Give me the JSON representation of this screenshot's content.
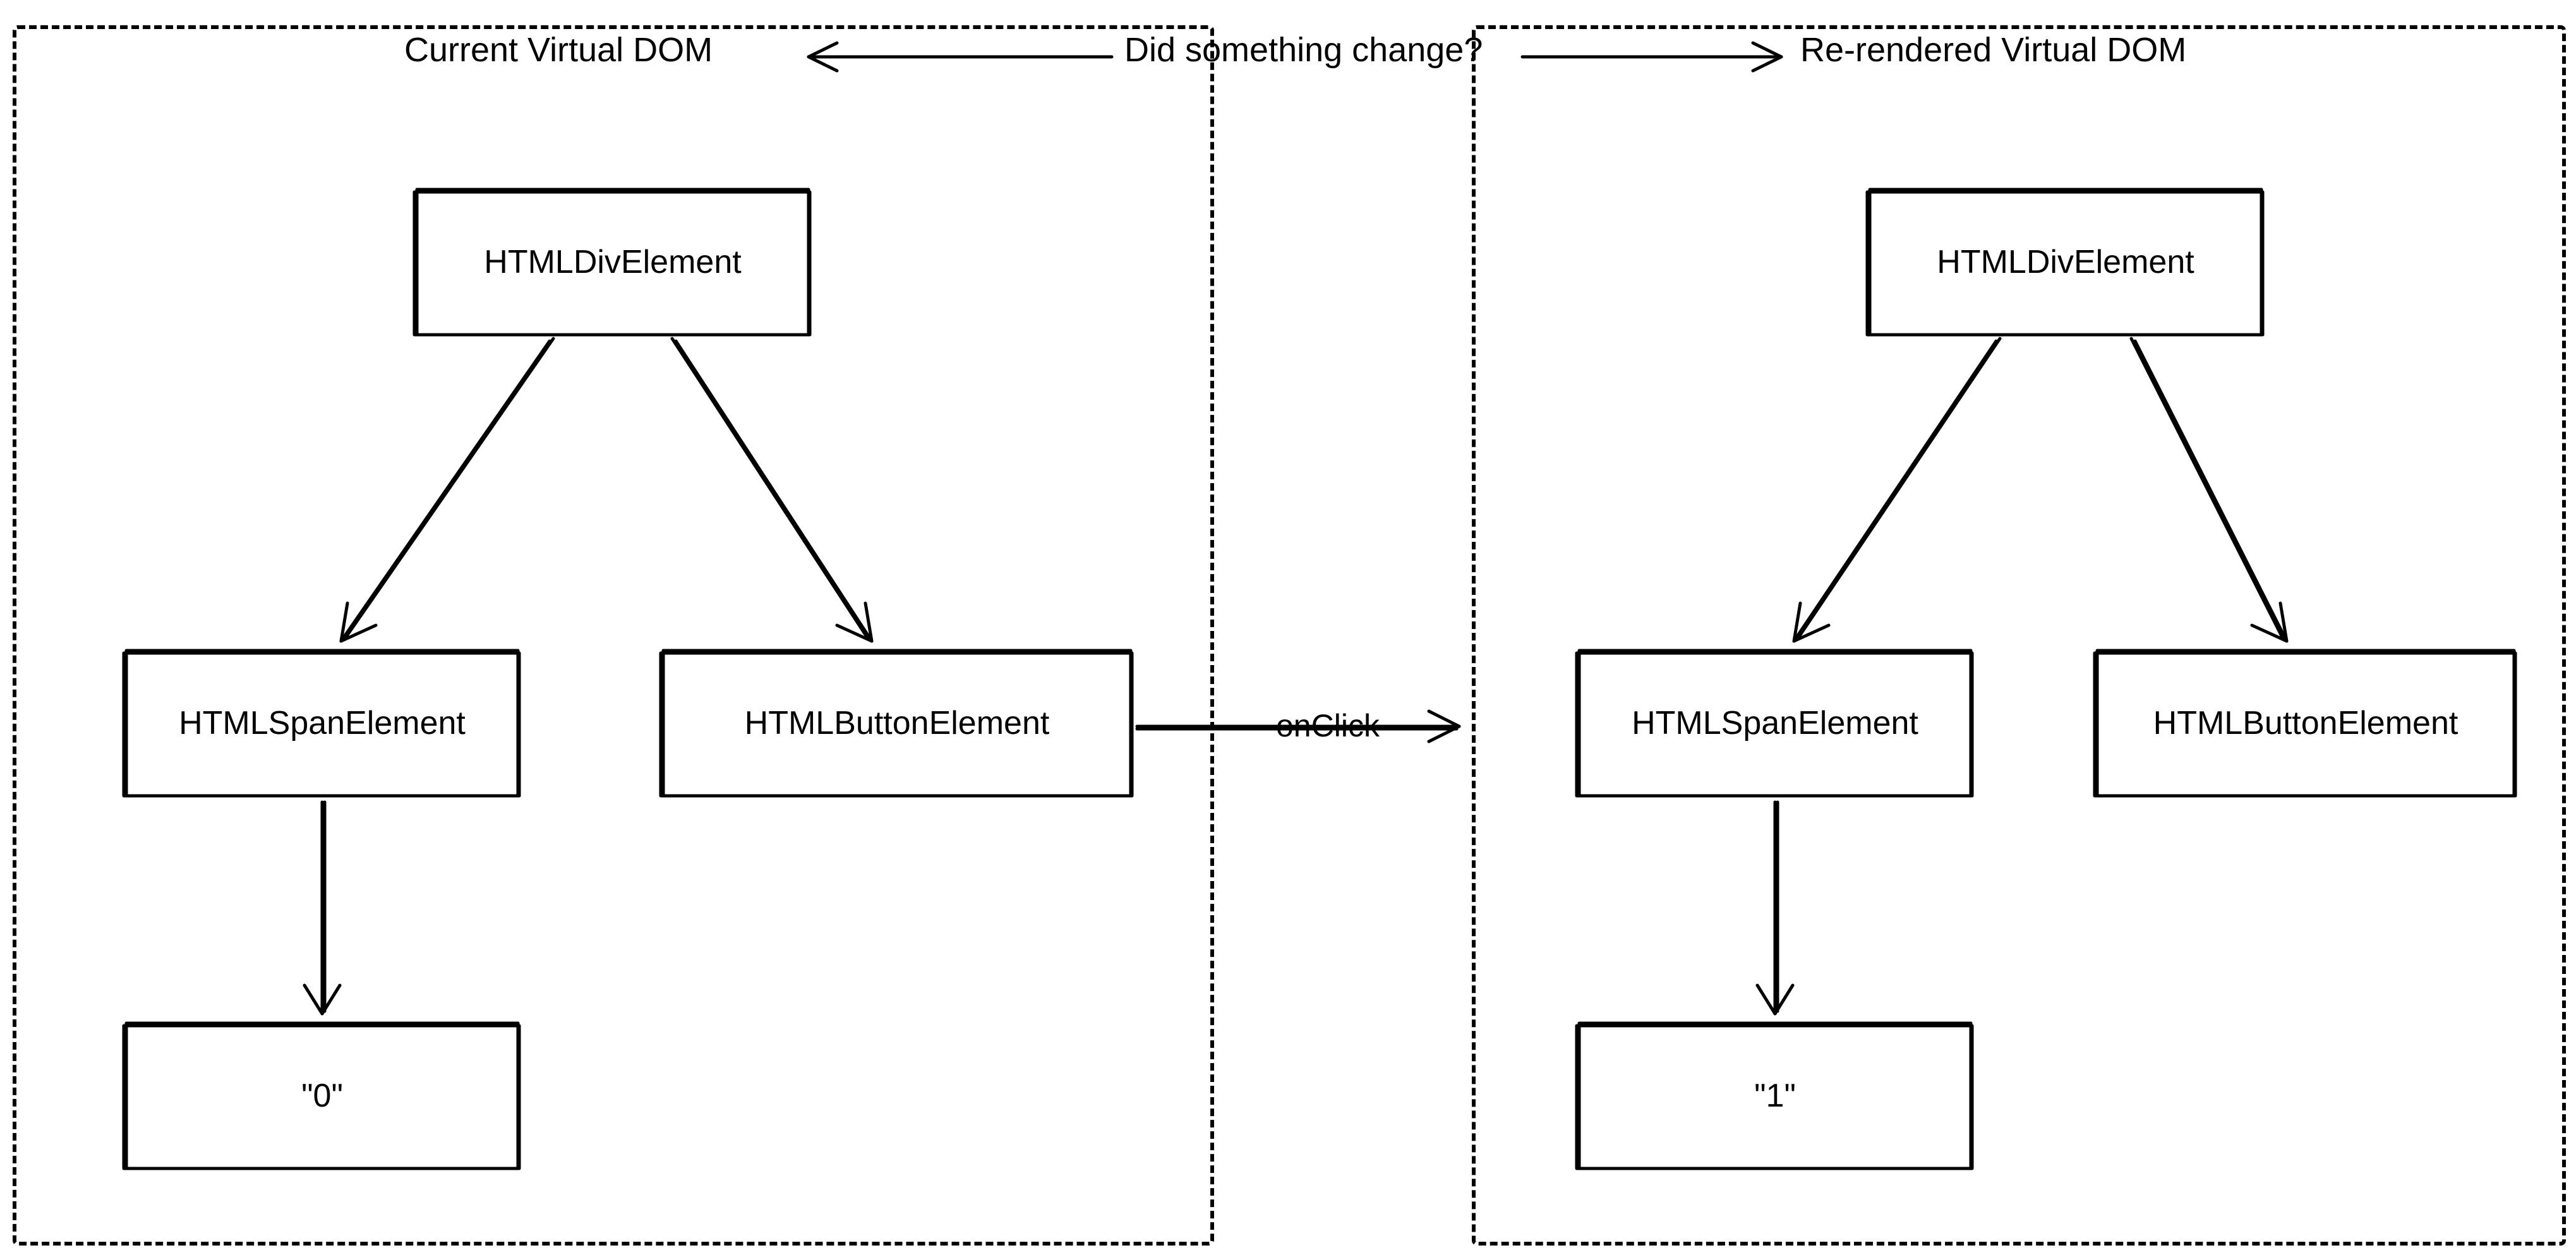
{
  "left": {
    "title": "Current Virtual DOM",
    "nodes": {
      "div": "HTMLDivElement",
      "span": "HTMLSpanElement",
      "button": "HTMLButtonElement",
      "value": "\"0\""
    }
  },
  "right": {
    "title": "Re-rendered Virtual DOM",
    "nodes": {
      "div": "HTMLDivElement",
      "span": "HTMLSpanElement",
      "button": "HTMLButtonElement",
      "value": "\"1\""
    }
  },
  "center": {
    "question": "Did something change?",
    "event": "onClick"
  }
}
